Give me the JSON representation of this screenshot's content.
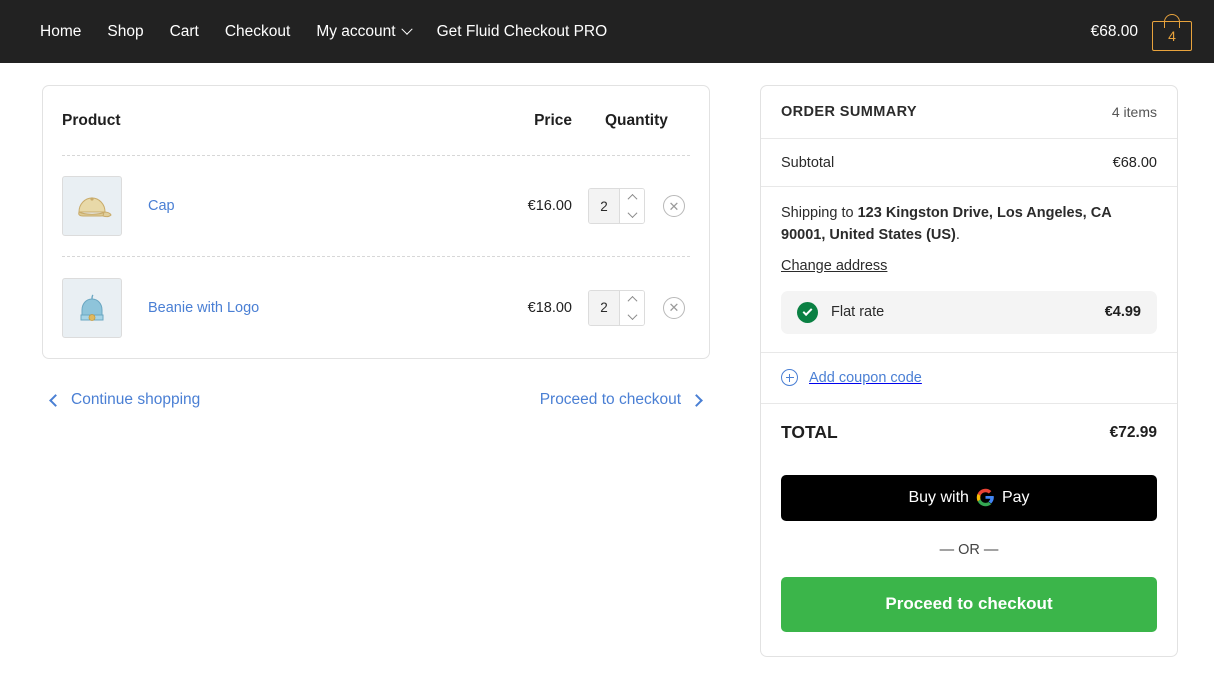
{
  "nav": {
    "links": [
      {
        "label": "Home"
      },
      {
        "label": "Shop"
      },
      {
        "label": "Cart"
      },
      {
        "label": "Checkout"
      }
    ],
    "account_label": "My account",
    "pro_label": "Get Fluid Checkout PRO",
    "cart_total": "€68.00",
    "cart_count": "4"
  },
  "cart": {
    "headers": {
      "product": "Product",
      "price": "Price",
      "quantity": "Quantity"
    },
    "items": [
      {
        "name": "Cap",
        "price": "€16.00",
        "qty": "2"
      },
      {
        "name": "Beanie with Logo",
        "price": "€18.00",
        "qty": "2"
      }
    ],
    "continue_shopping": "Continue shopping",
    "proceed_to_checkout": "Proceed to checkout"
  },
  "summary": {
    "title": "ORDER SUMMARY",
    "items_count": "4 items",
    "subtotal_label": "Subtotal",
    "subtotal_value": "€68.00",
    "shipping_prefix": "Shipping to ",
    "shipping_address": "123 Kingston Drive, Los Angeles, CA 90001, United States (US)",
    "shipping_suffix": ".",
    "change_address": "Change address",
    "rate_name": "Flat rate",
    "rate_price": "€4.99",
    "coupon_label": "Add coupon code",
    "total_label": "TOTAL",
    "total_value": "€72.99",
    "gpay_prefix": "Buy with",
    "gpay_suffix": "Pay",
    "or_label": "— OR —",
    "checkout_label": "Proceed to checkout"
  },
  "colors": {
    "nav_bg": "#222222",
    "accent_blue": "#4a7fd4",
    "cart_orange": "#e8a33d",
    "green_cta": "#3bb54a",
    "check_green": "#0a8043"
  }
}
